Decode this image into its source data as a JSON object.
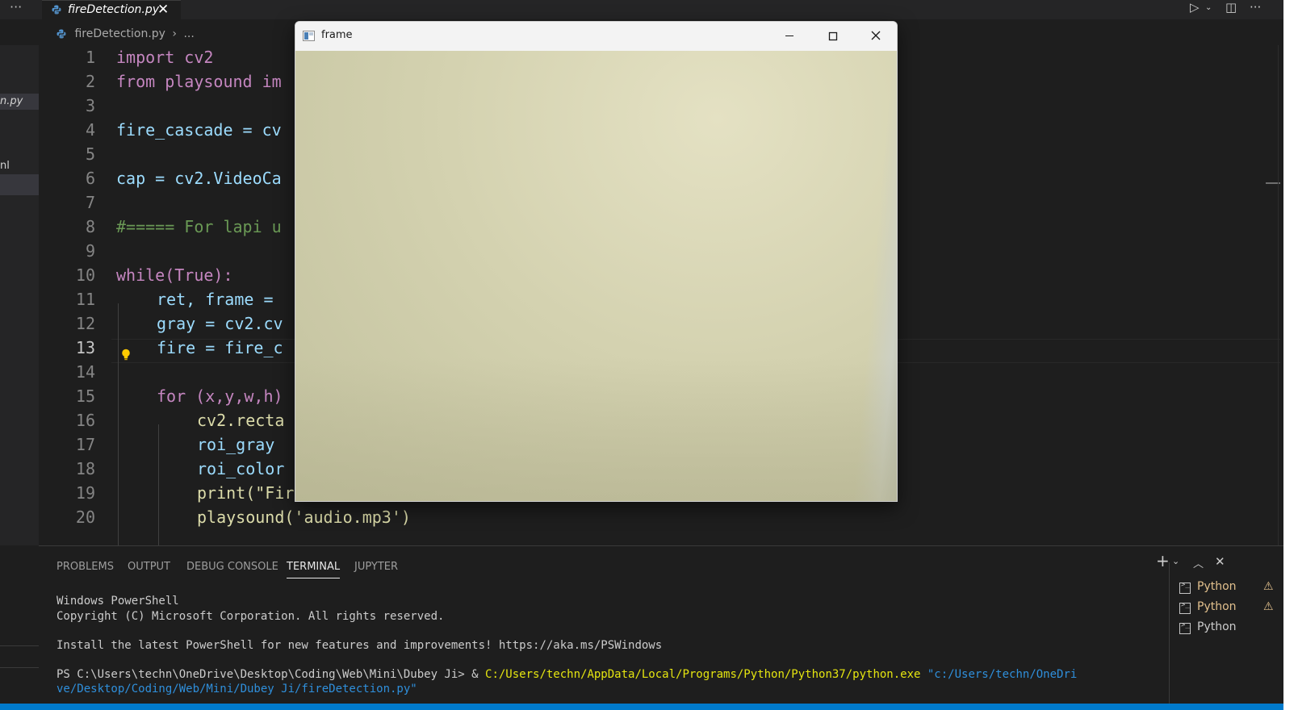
{
  "editor_tab": {
    "filename": "fireDetection.py"
  },
  "breadcrumb": {
    "file": "fireDetection.py",
    "separator": "›",
    "ellipsis": "..."
  },
  "sidebar": {
    "file1": "n.py",
    "file2": "nl"
  },
  "code_lines": [
    {
      "n": "1",
      "text": "import cv2"
    },
    {
      "n": "2",
      "text": "from playsound im"
    },
    {
      "n": "3",
      "text": ""
    },
    {
      "n": "4",
      "text": "fire_cascade = cv"
    },
    {
      "n": "5",
      "text": ""
    },
    {
      "n": "6",
      "text": "cap = cv2.VideoCa"
    },
    {
      "n": "7",
      "text": ""
    },
    {
      "n": "8",
      "text": "#===== For lapi u"
    },
    {
      "n": "9",
      "text": ""
    },
    {
      "n": "10",
      "text": "while(True):"
    },
    {
      "n": "11",
      "text": "ret, frame ="
    },
    {
      "n": "12",
      "text": "gray = cv2.cv"
    },
    {
      "n": "13",
      "text": "fire = fire_c"
    },
    {
      "n": "14",
      "text": ""
    },
    {
      "n": "15",
      "text": "for (x,y,w,h)"
    },
    {
      "n": "16",
      "text": "cv2.recta"
    },
    {
      "n": "17",
      "text": "roi_gray"
    },
    {
      "n": "18",
      "text": "roi_color"
    },
    {
      "n": "19",
      "text": "print(\"Fire is Detected\")"
    },
    {
      "n": "20",
      "text": "playsound('audio.mp3')"
    }
  ],
  "panel": {
    "tabs": [
      "PROBLEMS",
      "OUTPUT",
      "DEBUG CONSOLE",
      "TERMINAL",
      "JUPYTER"
    ],
    "active_tab": "TERMINAL",
    "terminal": {
      "line1": "Windows PowerShell",
      "line2": "Copyright (C) Microsoft Corporation. All rights reserved.",
      "line3": "Install the latest PowerShell for new features and improvements! https://aka.ms/PSWindows",
      "prompt": "PS C:\\Users\\techn\\OneDrive\\Desktop\\Coding\\Web\\Mini\\Dubey Ji> & ",
      "exe": "C:/Users/techn/AppData/Local/Programs/Python/Python37/python.exe",
      "script_part1": " \"c:/Users/techn/OneDri",
      "script_part2": "ve/Desktop/Coding/Web/Mini/Dubey Ji/fireDetection.py\""
    },
    "terminal_list": [
      {
        "label": "Python",
        "warning": true
      },
      {
        "label": "Python",
        "warning": true
      },
      {
        "label": "Python",
        "warning": false
      }
    ],
    "accent_color": "#e2c08d"
  },
  "cv_window": {
    "title": "frame"
  },
  "status_bar": {
    "color": "#007acc"
  }
}
